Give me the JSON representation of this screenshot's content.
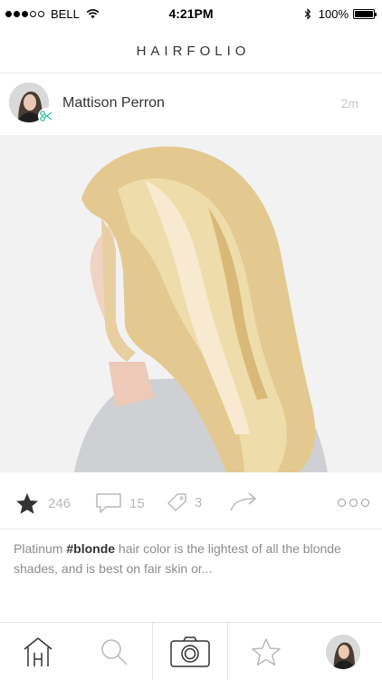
{
  "status_bar": {
    "carrier": "BELL",
    "time": "4:21PM",
    "battery": "100%"
  },
  "header": {
    "title": "HAIRFOLIO"
  },
  "post": {
    "author": "Mattison Perron",
    "time_ago": "2m",
    "likes": "246",
    "comments": "15",
    "tags": "3",
    "caption_pre": "Platinum ",
    "caption_tag": "#blonde",
    "caption_post": " hair color is the lightest of all the blonde shades, and is best on fair skin or..."
  },
  "icons": {
    "author_badge": "scissors-icon",
    "like": "star-icon",
    "comment": "comment-icon",
    "tag": "tag-icon",
    "share": "share-arrow-icon",
    "more": "more-icon"
  },
  "tab_bar": [
    "home-icon",
    "search-icon",
    "camera-icon",
    "star-icon",
    "profile-avatar"
  ],
  "colors": {
    "accent": "#35c7a4",
    "muted": "#b9b9b9",
    "text": "#333333"
  }
}
